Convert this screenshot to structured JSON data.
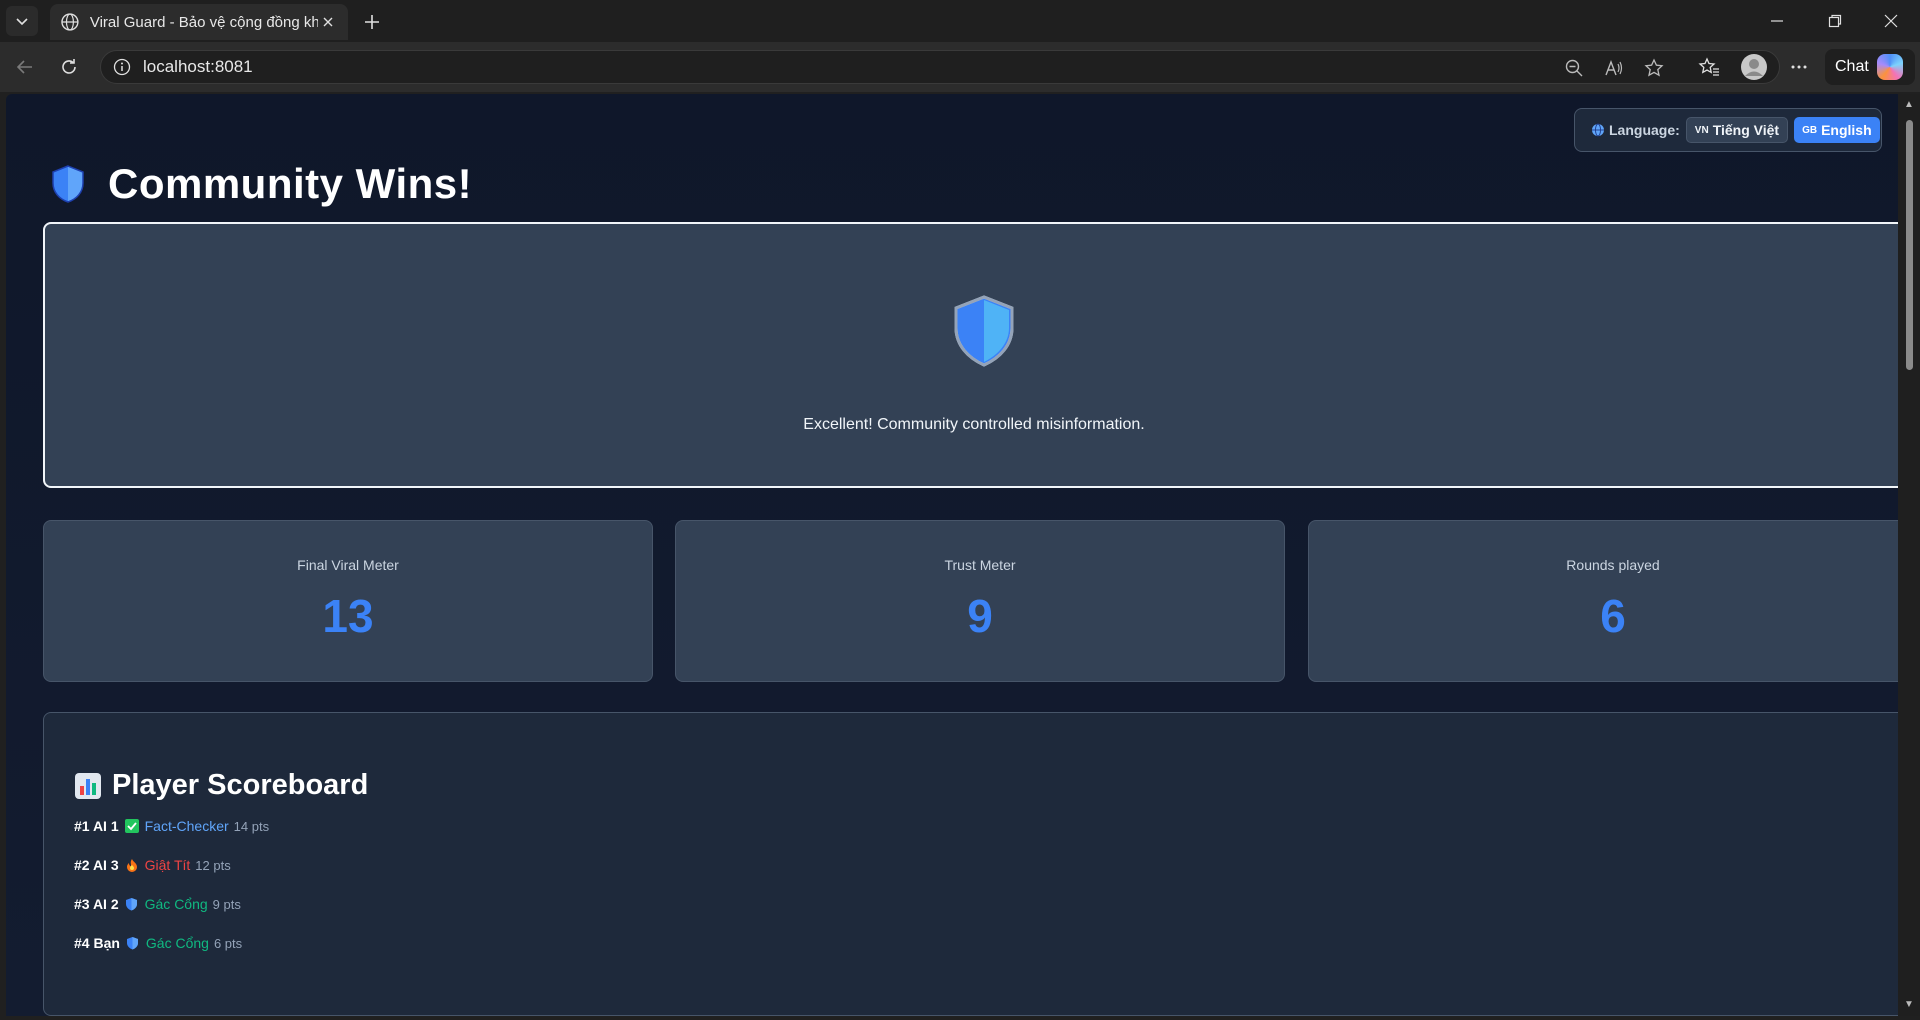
{
  "browser": {
    "tab_title": "Viral Guard - Bảo vệ cộng đồng khỏi tin giả",
    "url": "localhost:8081",
    "chat_label": "Chat"
  },
  "language": {
    "label": "Language:",
    "options": [
      {
        "flag": "VN",
        "label": "Tiếng Việt",
        "active": false
      },
      {
        "flag": "GB",
        "label": "English",
        "active": true
      }
    ]
  },
  "header": {
    "title": "Community Wins!",
    "icon": "shield-icon"
  },
  "result": {
    "icon": "shield-icon",
    "message": "Excellent! Community controlled misinformation."
  },
  "stats": [
    {
      "label": "Final Viral Meter",
      "value": "13"
    },
    {
      "label": "Trust Meter",
      "value": "9"
    },
    {
      "label": "Rounds played",
      "value": "6"
    }
  ],
  "scoreboard": {
    "title": "Player Scoreboard",
    "icon": "bar-chart-icon",
    "players": [
      {
        "rank_name": "#1 AI 1",
        "role_icon": "check-box-icon",
        "role": "Fact-Checker",
        "role_color": "#60a5fa",
        "points": "14 pts"
      },
      {
        "rank_name": "#2 AI 3",
        "role_icon": "fire-icon",
        "role": "Giật Tít",
        "role_color": "#ef4444",
        "points": "12 pts"
      },
      {
        "rank_name": "#3 AI 2",
        "role_icon": "shield-icon",
        "role": "Gác Cổng",
        "role_color": "#10b981",
        "points": "9 pts"
      },
      {
        "rank_name": "#4 Bạn",
        "role_icon": "shield-icon",
        "role": "Gác Cổng",
        "role_color": "#10b981",
        "points": "6 pts"
      }
    ]
  },
  "colors": {
    "accent": "#3b82f6",
    "background": "#0f172a",
    "card": "#334155"
  }
}
